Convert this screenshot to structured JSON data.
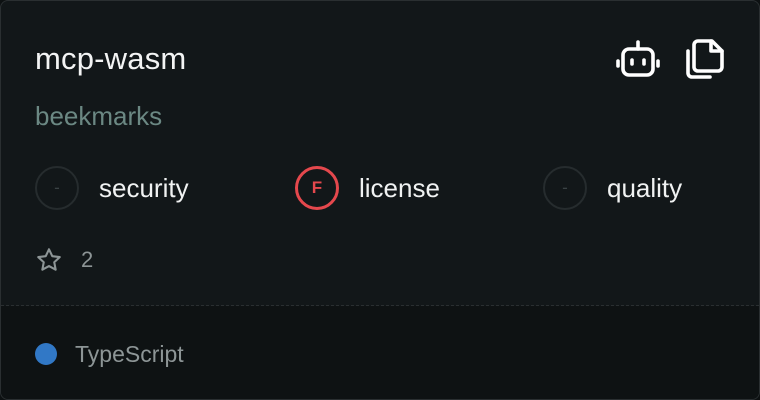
{
  "card": {
    "name": "mcp-wasm",
    "owner": "beekmarks"
  },
  "actions": {
    "bot_icon": "robot-icon",
    "copy_icon": "copy-icon"
  },
  "scores": {
    "security": {
      "grade": "-",
      "label": "security"
    },
    "license": {
      "grade": "F",
      "label": "license"
    },
    "quality": {
      "grade": "-",
      "label": "quality"
    }
  },
  "stars": {
    "icon": "star-icon",
    "count": "2"
  },
  "language": {
    "name": "TypeScript",
    "color": "#3178c6"
  },
  "colors": {
    "fail": "#e5484d",
    "owner": "#6b8883"
  }
}
